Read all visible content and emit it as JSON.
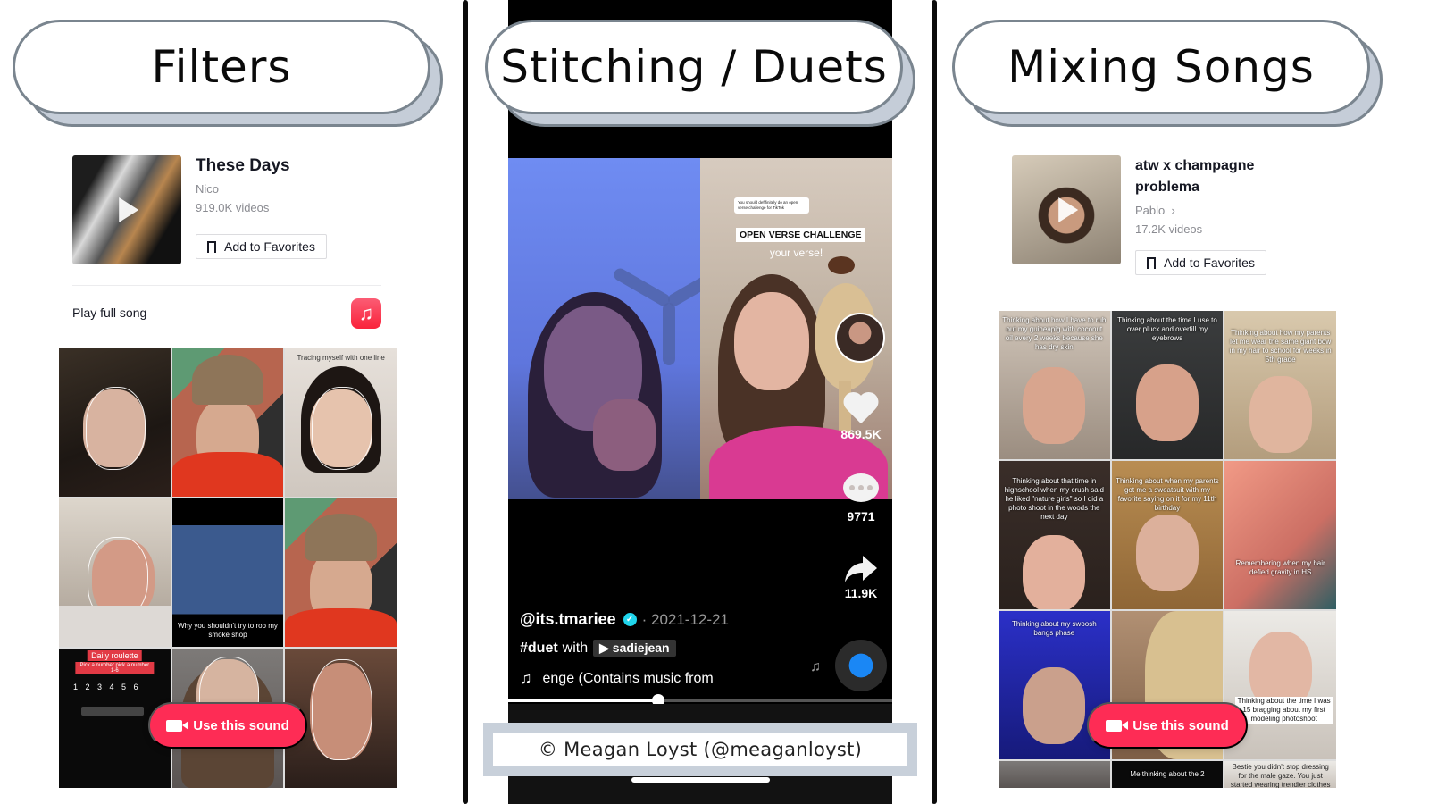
{
  "panels": [
    {
      "heading": "Filters",
      "sound": {
        "title": "These Days",
        "artist": "Nico",
        "video_count": "919.0K videos",
        "favorite_label": "Add to Favorites"
      },
      "play_full_song": "Play full song",
      "grid_captions": [
        "",
        "",
        "Tracing myself with one line",
        "",
        "Why you shouldn't try to rob my smoke shop",
        "",
        "Daily roulette",
        "",
        ""
      ],
      "roulette": {
        "tag": "Daily roulette",
        "sub": "Pick a number pick a number 1-6",
        "numbers": "1 2 3 4 5 6"
      },
      "use_sound_label": "Use this sound"
    },
    {
      "heading": "Stitching / Duets",
      "video": {
        "reply_comment": "You should defffinitely do an open verse challenge for TikTok",
        "overlay_title": "OPEN VERSE CHALLENGE",
        "overlay_sub": "your verse!",
        "likes": "869.5K",
        "comments": "9771",
        "shares": "11.9K",
        "author": "@its.tmariee",
        "date": "· 2021-12-21",
        "duet_tag": "#duet",
        "duet_with": "with",
        "duet_partner": "sadiejean",
        "music_text": "enge (Contains music from",
        "progress_fraction": 0.39
      },
      "credit": "© Meagan Loyst (@meaganloyst)"
    },
    {
      "heading": "Mixing Songs",
      "sound": {
        "title": "atw x champagne problema",
        "artist": "Pablo",
        "video_count": "17.2K videos",
        "favorite_label": "Add to Favorites"
      },
      "grid_captions": [
        "Thinking about how I have to rub out my guineapig with coconut oil every 2 weeks because she has dry skin",
        "Thinking about the time I use to over pluck and overfill my eyebrows",
        "Thinking about how my parents let me wear the same giant bow in my hair to school for weeks in 5th grade",
        "Thinking about that time in highschool when my crush said he liked \"nature girls\" so I did a photo shoot in the woods the next day",
        "Thinking about when my parents got me a sweatsuit with my favorite saying on it for my 11th birthday",
        "Remembering when my hair defied gravity in HS",
        "Thinking about my swoosh bangs phase",
        "",
        "Thinking about the time I was 15 bragging about my first modeling photoshoot"
      ],
      "grid_extra_captions": {
        "row4_mid": "Me thinking about the 2",
        "row4_right": "Bestie you didn't stop dressing for the male gaze. You just started wearing trendier clothes"
      },
      "use_sound_label": "Use this sound"
    }
  ],
  "colors": {
    "tiktok_red": "#fe2c55",
    "pill_border": "#7a858f",
    "pill_shadow": "#c5cdd8",
    "verified": "#20d5ec"
  }
}
